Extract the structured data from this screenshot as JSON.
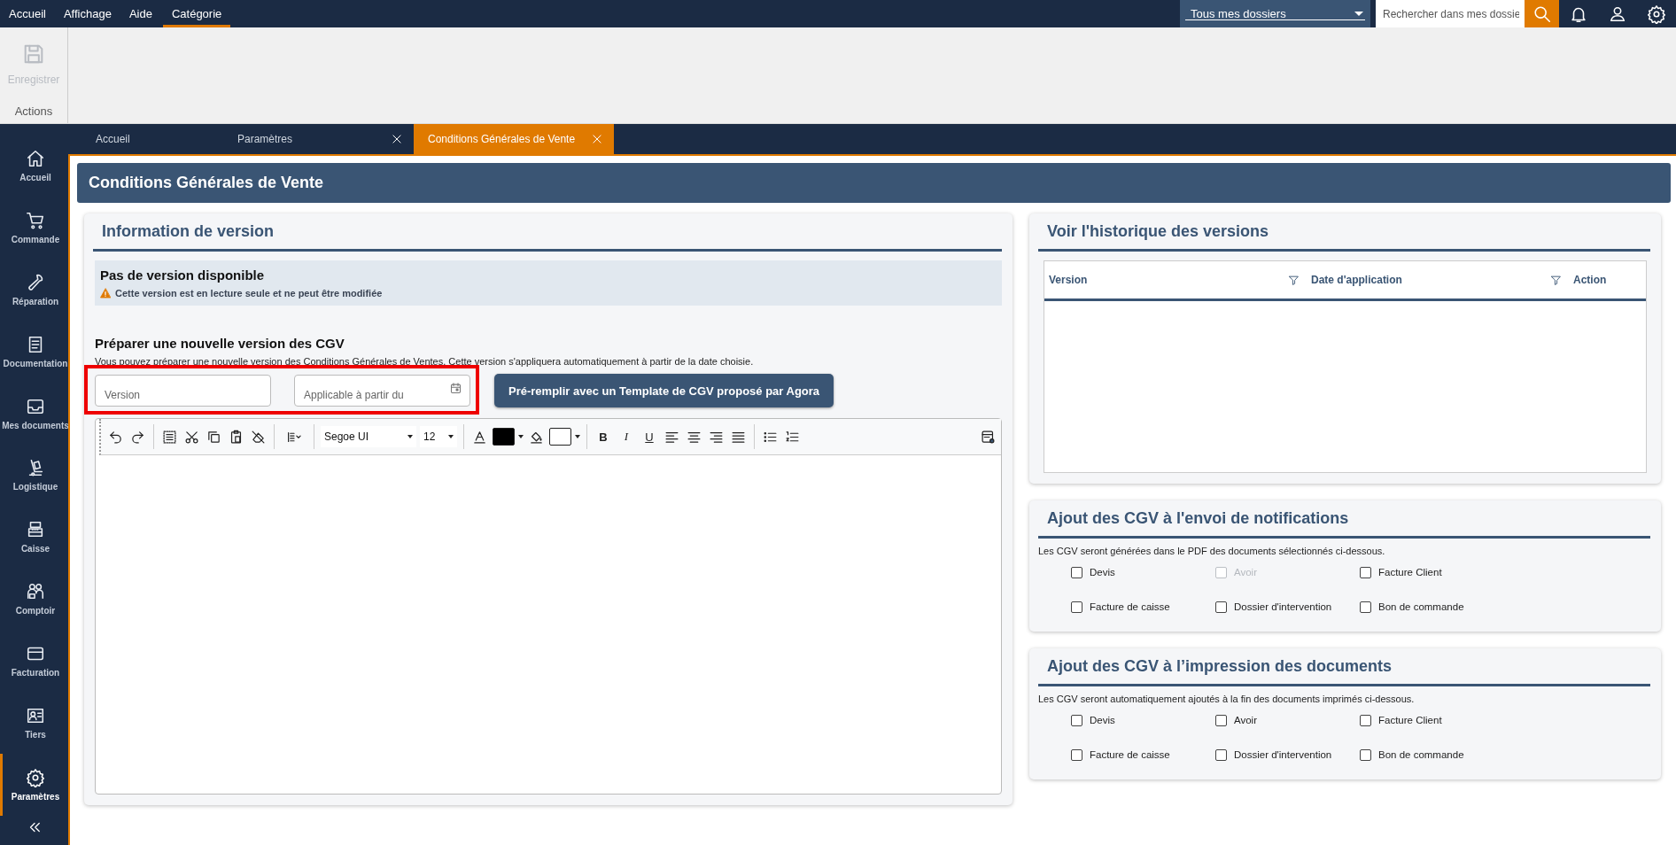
{
  "menu": [
    {
      "label": "Accueil",
      "selected": false
    },
    {
      "label": "Affichage",
      "selected": false
    },
    {
      "label": "Aide",
      "selected": false
    },
    {
      "label": "Catégorie",
      "selected": true
    }
  ],
  "folder_select": {
    "value": "Tous mes dossiers"
  },
  "search": {
    "placeholder": "Rechercher dans mes dossie"
  },
  "ribbon": {
    "save_label": "Enregistrer",
    "save_disabled": true,
    "group_label": "Actions"
  },
  "sidebar": {
    "items": [
      {
        "label": "Accueil",
        "selected": false
      },
      {
        "label": "Commande",
        "selected": false
      },
      {
        "label": "Réparation",
        "selected": false
      },
      {
        "label": "Documentation",
        "selected": false
      },
      {
        "label": "Mes documents",
        "selected": false
      },
      {
        "label": "Logistique",
        "selected": false
      },
      {
        "label": "Caisse",
        "selected": false
      },
      {
        "label": "Comptoir",
        "selected": false
      },
      {
        "label": "Facturation",
        "selected": false
      },
      {
        "label": "Tiers",
        "selected": false
      },
      {
        "label": "Paramètres",
        "selected": true
      }
    ]
  },
  "tabs": [
    {
      "label": "Accueil",
      "selected": false,
      "closable": false
    },
    {
      "label": "Paramètres",
      "selected": false,
      "closable": true
    },
    {
      "label": "Conditions Générales de Vente",
      "selected": true,
      "closable": true
    }
  ],
  "page_title": "Conditions Générales de Vente",
  "version_panel": {
    "title": "Information de version",
    "notice_title": "Pas de version disponible",
    "notice_text": "Cette version est en lecture seule et ne peut être modifiée",
    "prepare_title": "Préparer une nouvelle version des CGV",
    "prepare_text": "Vous pouvez préparer une nouvelle version des Conditions Générales de Ventes. Cette version s'appliquera automatiquement à partir de la date choisie.",
    "fields_highlighted": true,
    "version_placeholder": "Version",
    "date_placeholder": "Applicable à partir du",
    "prefill_button": "Pré-remplir avec un Template de CGV proposé par Agora",
    "editor": {
      "font": "Segoe UI",
      "size": "12",
      "swatches": [
        {
          "kind": "font",
          "color": "#000000"
        },
        {
          "kind": "highlight",
          "color": "#ffffff"
        }
      ],
      "bold": "B",
      "italic": "I",
      "underline": "U"
    }
  },
  "history_panel": {
    "title": "Voir l'historique des versions",
    "columns": [
      {
        "label": "Version",
        "filterable": true
      },
      {
        "label": "Date d'application",
        "filterable": true
      },
      {
        "label": "Action",
        "filterable": false
      }
    ]
  },
  "checkbox_panels": [
    {
      "title": "Ajout des CGV à l'envoi de notifications",
      "text": "Les CGV seront générées dans le PDF des documents sélectionnés ci-dessous.",
      "options": [
        {
          "label": "Devis",
          "checked": false,
          "disabled": false
        },
        {
          "label": "Avoir",
          "checked": false,
          "disabled": true
        },
        {
          "label": "Facture Client",
          "checked": false,
          "disabled": false
        },
        {
          "label": "Facture de caisse",
          "checked": false,
          "disabled": false
        },
        {
          "label": "Dossier d'intervention",
          "checked": false,
          "disabled": false
        },
        {
          "label": "Bon de commande",
          "checked": false,
          "disabled": false
        }
      ]
    },
    {
      "title": "Ajout des CGV à l’impression des documents",
      "text": "Les CGV seront automatiquement ajoutés à la fin des documents imprimés ci-dessous.",
      "options": [
        {
          "label": "Devis",
          "checked": false,
          "disabled": false
        },
        {
          "label": "Avoir",
          "checked": false,
          "disabled": false
        },
        {
          "label": "Facture Client",
          "checked": false,
          "disabled": false
        },
        {
          "label": "Facture de caisse",
          "checked": false,
          "disabled": false
        },
        {
          "label": "Dossier d'intervention",
          "checked": false,
          "disabled": false
        },
        {
          "label": "Bon de commande",
          "checked": false,
          "disabled": false
        }
      ]
    }
  ]
}
